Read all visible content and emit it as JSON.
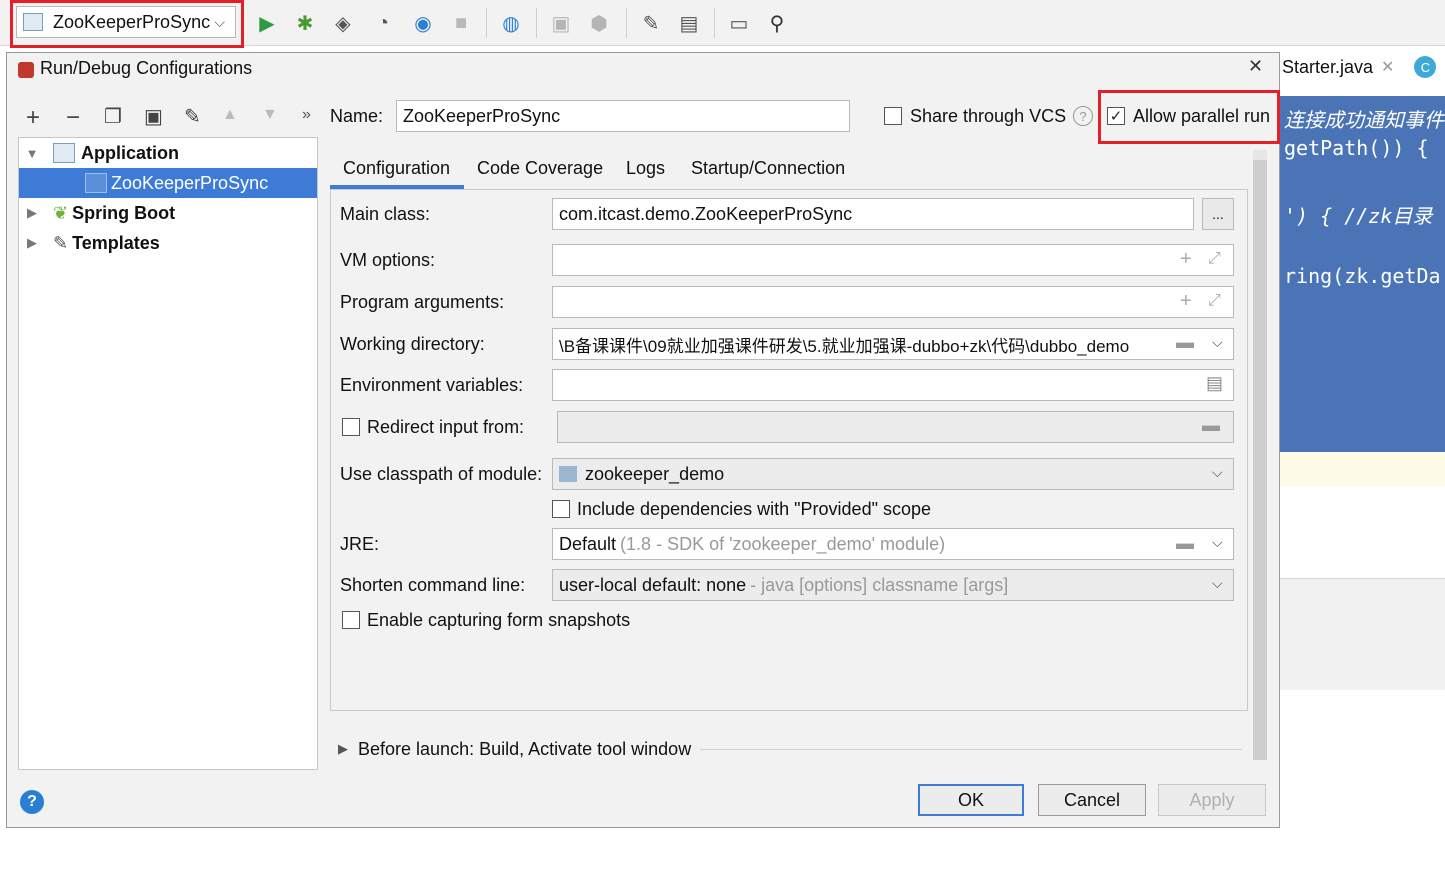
{
  "toolbar": {
    "run_config": "ZooKeeperProSync",
    "icons": [
      "run-icon",
      "debug-icon",
      "coverage-icon",
      "profile-icon",
      "attach-icon",
      "stop-icon",
      "update-icon",
      "build-icon",
      "build-artifacts-icon",
      "settings-icon",
      "project-structure-icon",
      "terminal-icon",
      "search-icon"
    ]
  },
  "editor": {
    "tab_label": "Starter.java",
    "code_lines": [
      "连接成功通知事件",
      "getPath()) {",
      "') {  //zk目录",
      "ring(zk.getDa"
    ]
  },
  "dialog": {
    "title": "Run/Debug Configurations",
    "name_label": "Name:",
    "name_value": "ZooKeeperProSync",
    "share_vcs": "Share through VCS",
    "allow_parallel": "Allow parallel run",
    "tree": {
      "application": "Application",
      "app_child": "ZooKeeperProSync",
      "spring_boot": "Spring Boot",
      "templates": "Templates"
    },
    "tabs": [
      "Configuration",
      "Code Coverage",
      "Logs",
      "Startup/Connection"
    ],
    "form": {
      "main_class_label": "Main class:",
      "main_class_value": "com.itcast.demo.ZooKeeperProSync",
      "vm_options_label": "VM options:",
      "program_args_label": "Program arguments:",
      "working_dir_label": "Working directory:",
      "working_dir_value": "\\B备课课件\\09就业加强课件研发\\5.就业加强课-dubbo+zk\\代码\\dubbo_demo",
      "env_vars_label": "Environment variables:",
      "redirect_label": "Redirect input from:",
      "classpath_label": "Use classpath of module:",
      "classpath_value": "zookeeper_demo",
      "include_deps": "Include dependencies with \"Provided\" scope",
      "jre_label": "JRE:",
      "jre_value": "Default",
      "jre_hint": "(1.8 - SDK of 'zookeeper_demo' module)",
      "shorten_label": "Shorten command line:",
      "shorten_value": "user-local default: none",
      "shorten_hint": "- java [options] classname [args]",
      "capture_snapshots": "Enable capturing form snapshots",
      "more_button": "..."
    },
    "before_launch": "Before launch: Build, Activate tool window",
    "buttons": {
      "ok": "OK",
      "cancel": "Cancel",
      "apply": "Apply"
    }
  },
  "colors": {
    "accent": "#3d7bd6",
    "highlight_red": "#e41f26",
    "run_green": "#2e9a41"
  }
}
